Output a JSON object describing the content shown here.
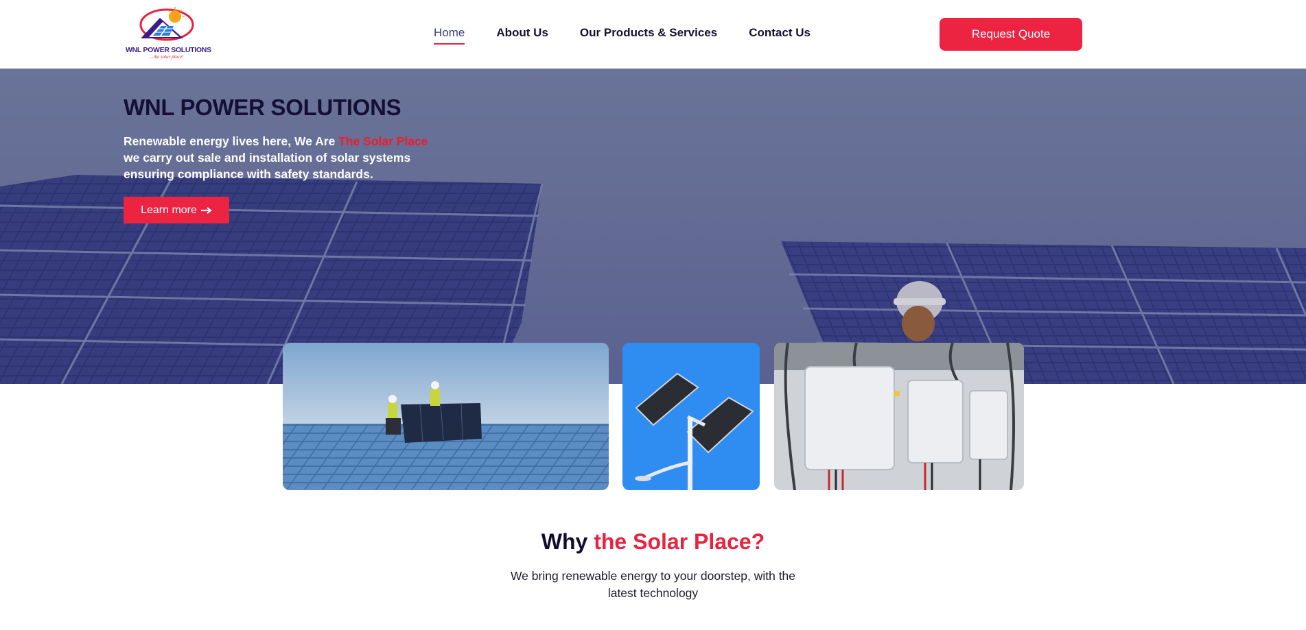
{
  "header": {
    "logo": {
      "name": "WNL POWER SOLUTIONS",
      "tagline": "...the solar place!",
      "icon": "solar-house-logo"
    },
    "nav": [
      {
        "label": "Home",
        "active": true
      },
      {
        "label": "About Us",
        "active": false
      },
      {
        "label": "Our Products & Services",
        "active": false
      },
      {
        "label": "Contact Us",
        "active": false
      }
    ],
    "quote_button": "Request Quote"
  },
  "hero": {
    "title": "WNL POWER SOLUTIONS",
    "line1_prefix": "Renewable energy lives here, We Are ",
    "line1_accent": "The Solar Place",
    "line2": "we carry out sale and installation of solar systems",
    "line3": "ensuring compliance with safety standards.",
    "button_label": "Learn more",
    "button_icon": "arrow-right-icon"
  },
  "gallery": [
    {
      "subject": "workers-installing-solar-panel"
    },
    {
      "subject": "solar-street-light"
    },
    {
      "subject": "solar-inverters"
    }
  ],
  "why": {
    "title_prefix": "Why ",
    "title_accent": "the Solar Place?",
    "text_line1": "We bring renewable energy to your doorstep, with the",
    "text_line2": "latest technology"
  },
  "colors": {
    "accent": "#ec2341",
    "navy": "#150e35",
    "hero_overlay": "#646c94"
  }
}
